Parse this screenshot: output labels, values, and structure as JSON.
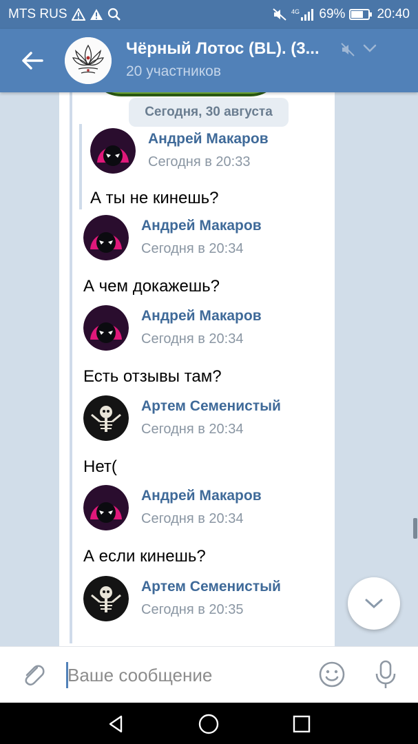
{
  "status_bar": {
    "carrier": "MTS RUS",
    "battery": "69%",
    "time": "20:40",
    "icons": [
      "warning-icon",
      "warning-icon",
      "search-icon",
      "mute-icon",
      "signal-icon",
      "battery-icon"
    ]
  },
  "header": {
    "title": "Чёрный Лотос (BL). (3...",
    "subtitle": "20 участников"
  },
  "date_divider": "Сегодня, 30 августа",
  "quoted": {
    "name": "Андрей Макаров",
    "time": "Сегодня в 20:33",
    "text": "А ты не кинешь?"
  },
  "messages": [
    {
      "name": "Андрей Макаров",
      "time": "Сегодня в 20:34",
      "text": "А чем докажешь?",
      "avatar": "spider-avatar"
    },
    {
      "name": "Андрей Макаров",
      "time": "Сегодня в 20:34",
      "text": "Есть отзывы там?",
      "avatar": "spider-avatar"
    },
    {
      "name": "Артем Семенистый",
      "time": "Сегодня в 20:34",
      "text": "Нет(",
      "avatar": "skeleton-avatar"
    },
    {
      "name": "Андрей Макаров",
      "time": "Сегодня в 20:34",
      "text": "А если кинешь?",
      "avatar": "spider-avatar"
    },
    {
      "name": "Артем Семенистый",
      "time": "Сегодня в 20:35",
      "text": "",
      "avatar": "skeleton-avatar"
    }
  ],
  "composer": {
    "placeholder": "Ваше сообщение"
  },
  "colors": {
    "header": "#5181b8",
    "status_bar": "#4a76a8",
    "name_link": "#3f6a99",
    "background": "#d1dde9"
  }
}
